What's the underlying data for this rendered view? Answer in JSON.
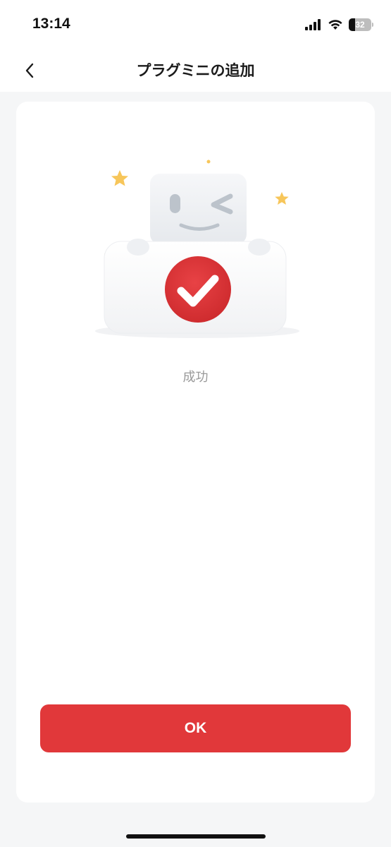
{
  "status_bar": {
    "time": "13:14",
    "battery_level": "32",
    "icons": [
      "signal-icon",
      "wifi-icon",
      "battery-icon"
    ]
  },
  "header": {
    "title": "プラグミニの追加",
    "back_icon": "chevron-left-icon"
  },
  "result": {
    "message": "成功",
    "illustration_icon": "robot-success-checkmark-icon"
  },
  "actions": {
    "ok_label": "OK"
  },
  "colors": {
    "accent": "#e1383a",
    "background": "#f5f6f7",
    "card": "#ffffff",
    "message_text": "#9a9a9a",
    "star": "#f7c65a"
  }
}
